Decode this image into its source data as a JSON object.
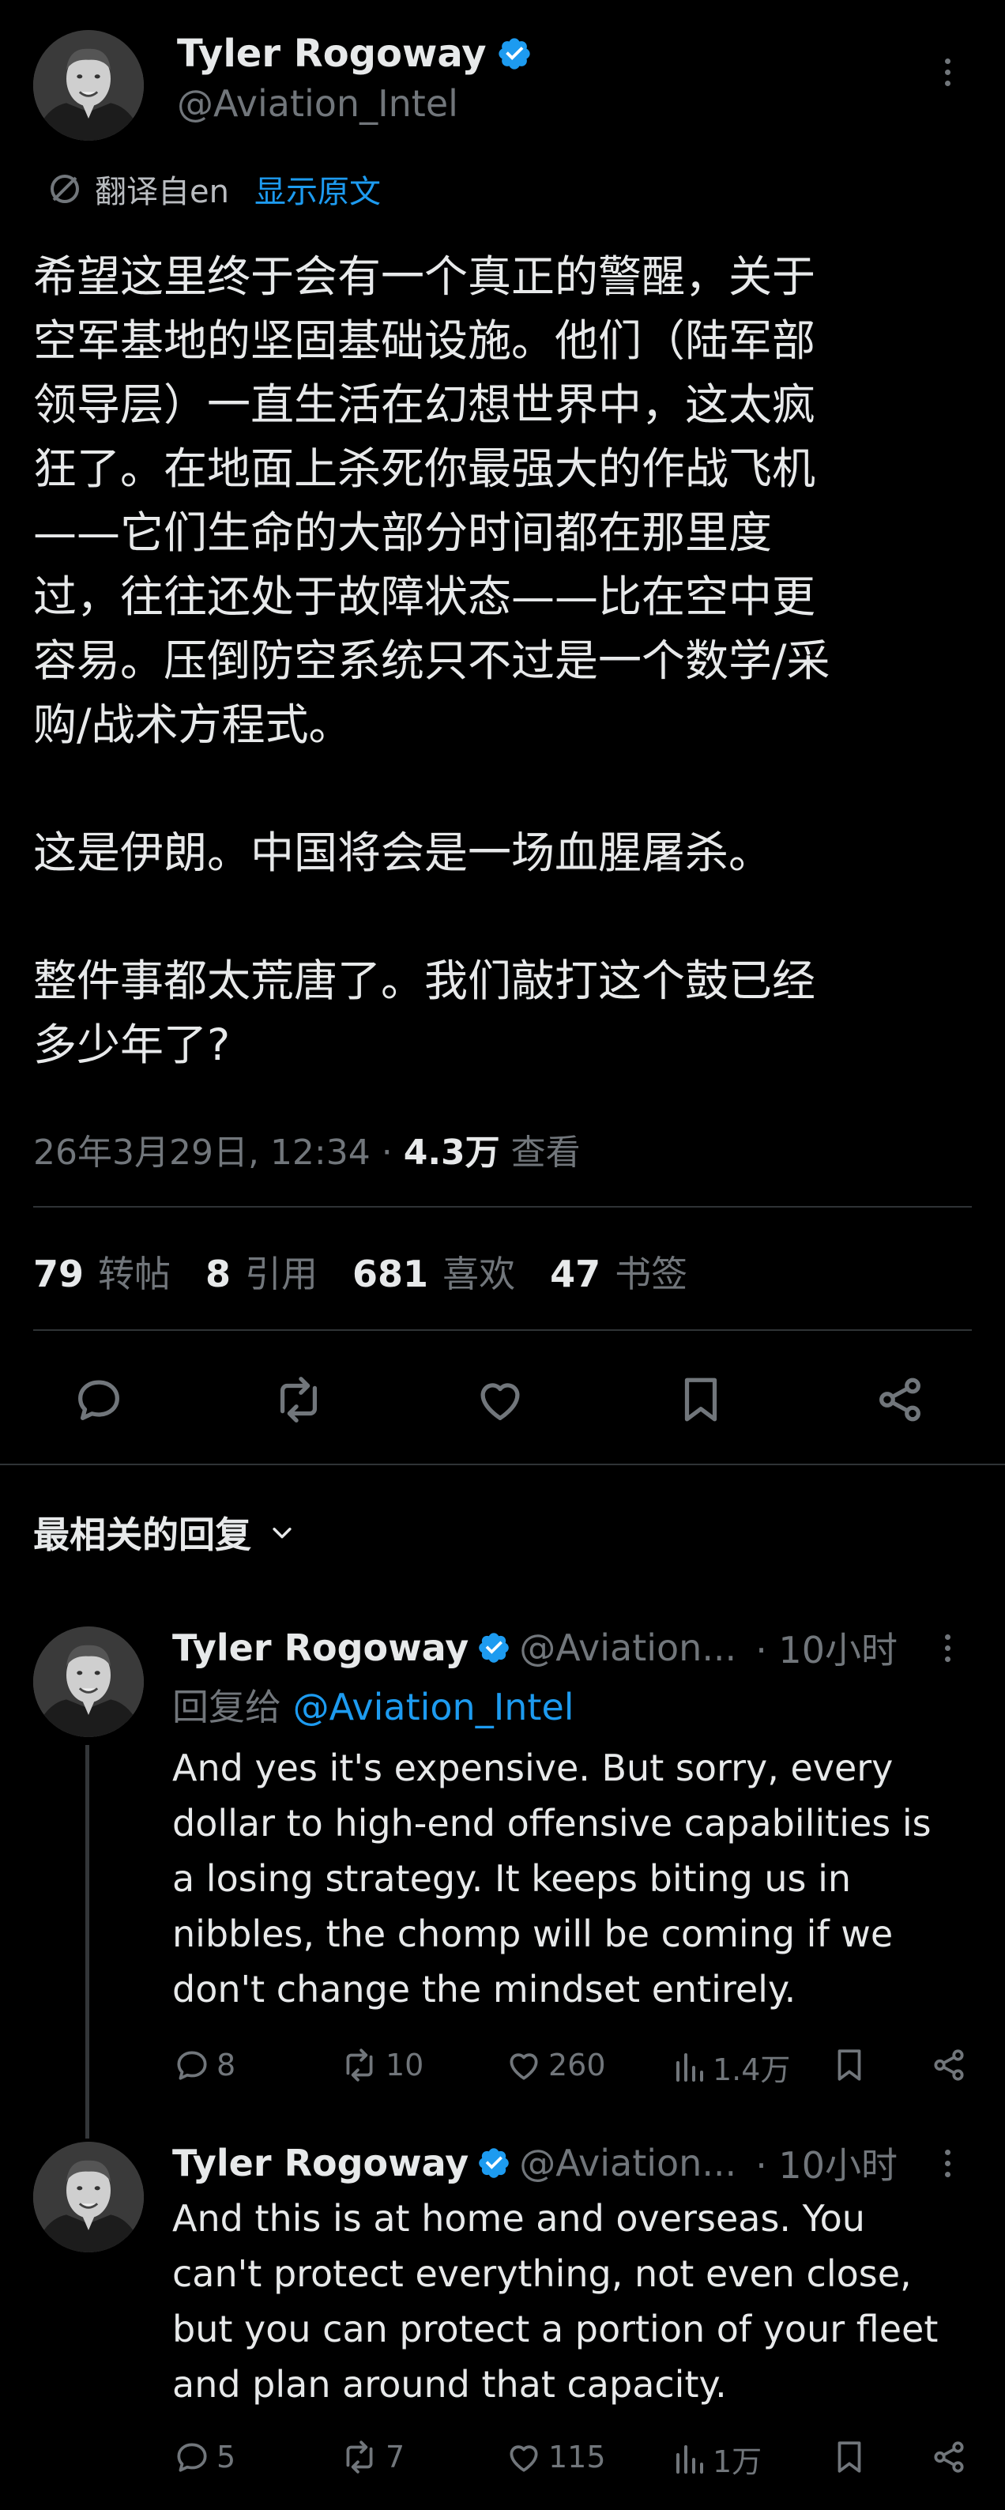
{
  "tweet": {
    "author_name": "Tyler Rogoway",
    "author_handle": "@Aviation_Intel",
    "translate_label": "翻译自en",
    "show_original": "显示原文",
    "paragraphs": [
      [
        "希望这里终于会有一个真正的警醒，关于",
        "空军基地的坚固基础设施。他们（陆军部",
        "领导层）一直生活在幻想世界中，这太疯",
        "狂了。在地面上杀死你最强大的作战飞机",
        "——它们生命的大部分时间都在那里度",
        "过，往往还处于故障状态——比在空中更",
        "容易。压倒防空系统只不过是一个数学/采",
        "购/战术方程式。"
      ],
      [
        "这是伊朗。中国将会是一场血腥屠杀。"
      ],
      [
        "整件事都太荒唐了。我们敲打这个鼓已经",
        "多少年了?"
      ]
    ],
    "timestamp": "26年3月29日, 12:34 · ",
    "views_count": "4.3万",
    "views_label": " 查看",
    "stats": [
      {
        "num": "79",
        "label": "转帖"
      },
      {
        "num": "8",
        "label": "引用"
      },
      {
        "num": "681",
        "label": "喜欢"
      },
      {
        "num": "47",
        "label": "书签"
      }
    ]
  },
  "replies_header": "最相关的回复",
  "replies": [
    {
      "name": "Tyler Rogoway",
      "handle": "@Aviation...",
      "time": "· 10小时",
      "reply_to_label": "回复给 ",
      "reply_to_handle": "@Aviation_Intel",
      "lines": [
        "And yes it's expensive. But sorry, every",
        "dollar to high-end offensive capabilities is",
        "a losing strategy. It keeps biting us in",
        "nibbles, the chomp will be coming if we",
        "don't change the mindset entirely."
      ],
      "replies": "8",
      "reposts": "10",
      "likes": "260",
      "views": "1.4万"
    },
    {
      "name": "Tyler Rogoway",
      "handle": "@Aviation...",
      "time": "· 10小时",
      "lines": [
        "And this is at home and overseas. You",
        "can't protect everything, not even close,",
        "but you can protect a portion of your fleet",
        "and plan around that capacity."
      ],
      "replies": "5",
      "reposts": "7",
      "likes": "115",
      "views": "1万"
    }
  ],
  "colors": {
    "background": "#000000",
    "text": "#e7e9ea",
    "muted": "#71767b",
    "accent": "#1d9bf0",
    "divider": "#2f3336"
  }
}
